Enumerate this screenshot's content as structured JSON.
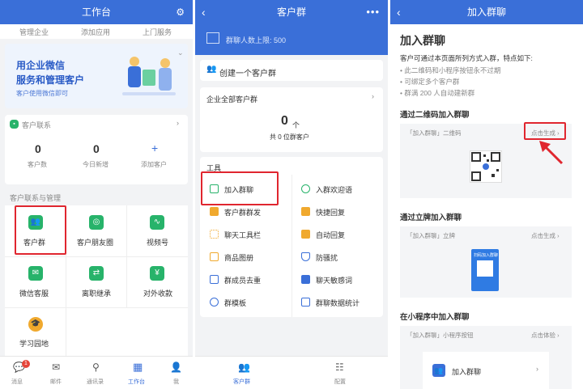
{
  "panel1": {
    "title": "工作台",
    "top_row": [
      "管理企业",
      "添加应用",
      "上门服务"
    ],
    "banner": {
      "line1": "用企业微信",
      "line2": "服务和管理客户",
      "sub": "客户使用微信即可"
    },
    "contacts": {
      "title": "客户联系",
      "stats": [
        {
          "value": "0",
          "label": "客户数"
        },
        {
          "value": "0",
          "label": "今日新增"
        },
        {
          "value": "+",
          "label": "添加客户"
        }
      ]
    },
    "section_label": "客户联系与管理",
    "grid": [
      "客户群",
      "客户朋友圈",
      "视频号",
      "微信客服",
      "离职继承",
      "对外收款",
      "学习园地"
    ],
    "tabbar": [
      {
        "label": "消息",
        "badge": "1"
      },
      {
        "label": "邮件"
      },
      {
        "label": "通讯录"
      },
      {
        "label": "工作台"
      },
      {
        "label": "我"
      }
    ]
  },
  "panel2": {
    "title": "客户群",
    "limit": "群聊人数上限: 500",
    "create": "创建一个客户群",
    "all_groups": "企业全部客户群",
    "count": "0",
    "count_unit": "个",
    "count_sub": "共 0 位群客户",
    "tools_label": "工具",
    "tools": [
      "加入群聊",
      "入群欢迎语",
      "客户群群发",
      "快捷回复",
      "聊天工具栏",
      "自动回复",
      "商品图册",
      "防骚扰",
      "群成员去重",
      "聊天敏感词",
      "群模板",
      "群聊数据统计"
    ],
    "tabbar": [
      "客户群",
      "配置"
    ]
  },
  "panel3": {
    "title": "加入群聊",
    "heading": "加入群聊",
    "desc": "客户可通过本页面所列方式入群，特点如下:",
    "bullets": [
      "此二维码和小程序按钮永不过期",
      "可绑定多个客户群",
      "群满 200 人自动建新群"
    ],
    "sections": [
      {
        "title": "通过二维码加入群聊",
        "card_label": "「加入群聊」二维码",
        "action": "点击生成 ›"
      },
      {
        "title": "通过立牌加入群聊",
        "card_label": "「加入群聊」立牌",
        "action": "点击生成 ›",
        "stand_text": "扫码加入群聊"
      },
      {
        "title": "在小程序中加入群聊",
        "card_label": "「加入群聊」小程序按钮",
        "action": "点击体验 ›",
        "button": "加入群聊"
      }
    ]
  },
  "colors": {
    "brand": "#3a6fd8",
    "highlight": "#e0262f",
    "green": "#27b36a"
  }
}
